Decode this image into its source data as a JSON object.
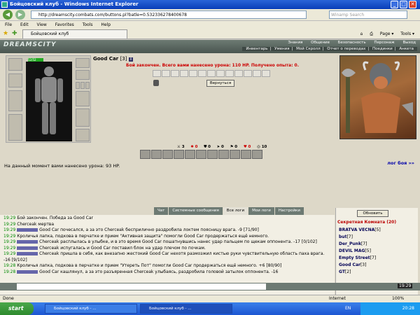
{
  "window": {
    "title": "Бойцовский клуб - Windows Internet Explorer",
    "min": "_",
    "max": "□",
    "close": "✕"
  },
  "browser": {
    "url": "http://dreamscity.combats.com/buttons.pl?batle=0.532336278400678",
    "search_placeholder": "Winamp Search",
    "menu": [
      "File",
      "Edit",
      "View",
      "Favorites",
      "Tools",
      "Help"
    ],
    "tab_title": "Бойцовский клуб",
    "toolbar_right": [
      "Page ▾",
      "Tools ▾"
    ]
  },
  "game": {
    "logo": "DREAMSCITY",
    "top_links": [
      "Знания",
      "Общение",
      "Безопасность",
      "Персонаж",
      "Выход"
    ],
    "sub_links": [
      "Инвентарь",
      "Умения",
      "Мой Скролл",
      "Отчет о переводах",
      "Поединки",
      "Анкета"
    ],
    "player_name": "Good Car",
    "player_level": "[3]",
    "hp_text": "52/52",
    "fight_message": "Бой закончен. Всего вами нанесено урона: 110 HP. Получено опыта: 0.",
    "back_button": "Вернуться",
    "stats": [
      "3",
      "0",
      "0",
      "0",
      "0",
      "0",
      "10"
    ],
    "damage_text": "На данный момент вами нанесено урона: 93 HP.",
    "log_link": "лог боя »»"
  },
  "chat": {
    "tabs": [
      "Чат",
      "Системные сообщения",
      "Все логи",
      "Мои логи",
      "Настройки"
    ],
    "active_tab": 2,
    "lines": [
      {
        "time": "19:29",
        "text": "Бой закончен. Победа за Good Car"
      },
      {
        "time": "19:29",
        "text": "Chercеak мертва"
      },
      {
        "time": "19:29",
        "text": "Good Car почесался, а за это Chercеak бесприлично раздробила локтем поясницу врага. -9 [71/90]"
      },
      {
        "time": "19:29",
        "text": "Кроличья лапка, подкова в перчатке и прием \"Активная защита\" помогли Good Car продержаться ещё немного."
      },
      {
        "time": "19:29",
        "text": "Chercеak расплылась в улыбке, и в это время Good Car пошатнувшись нанес удар пальцем по щекам оппонента. -17 [0/102]"
      },
      {
        "time": "19:29",
        "text": "Chercеak испугалась и Good Car поставил блок на удар плечом по почкам."
      },
      {
        "time": "19:29",
        "text": "Chercеak пришла в себя, как внезапно жестокий Good Car нехотя размозжил кистью руки чувствительную область паха врага. -16 [9/102]"
      },
      {
        "time": "19:28",
        "text": "Кроличья лапка, подкова в перчатке и прием \"Утереть Пот\" помогли Good Car продержаться ещё немного. +6 [80/90]"
      },
      {
        "time": "19:28",
        "text": "Good Car кашлянул, а за это разъяренная Chercеak улыбаясь, раздробила головой затылок оппонента. -16"
      }
    ]
  },
  "room": {
    "refresh_button": "Обновить",
    "title": "Секретная Комната (20)",
    "people": [
      {
        "name": "BRATVA VECNA",
        "level": "[5]"
      },
      {
        "name": "but",
        "level": "[7]"
      },
      {
        "name": "Der_Punk",
        "level": "[7]"
      },
      {
        "name": "DEVIL MAG",
        "level": "[5]"
      },
      {
        "name": "Empty Street",
        "level": "[7]"
      },
      {
        "name": "Good Car",
        "level": "[3]"
      },
      {
        "name": "GT",
        "level": "[2]"
      }
    ]
  },
  "status": {
    "left": "Done",
    "zone": "Internet",
    "zoom": "100%"
  },
  "taskbar": {
    "start": "start",
    "tasks": [
      "Бойцовский клуб - ...",
      "Бойцовский клуб - ..."
    ],
    "lang": "EN",
    "clock": "20:28"
  },
  "chat_clock": "19:29"
}
